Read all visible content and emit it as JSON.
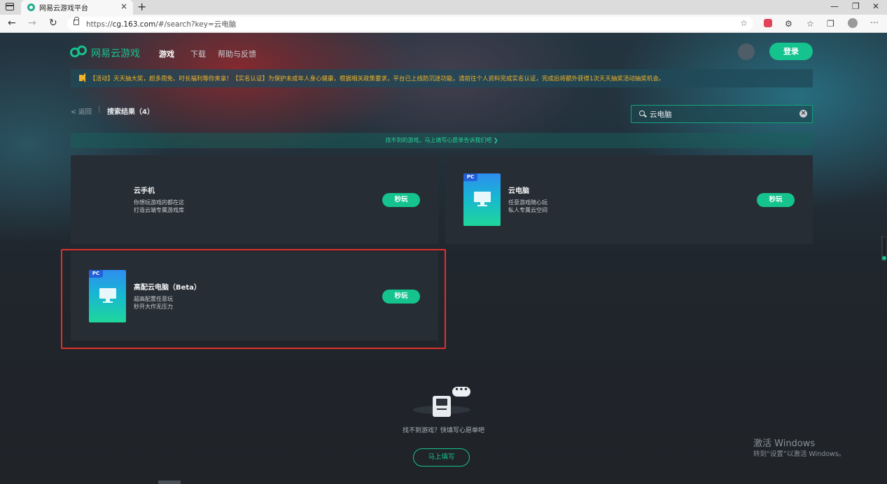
{
  "browser": {
    "tab_title": "网易云游戏平台",
    "tab_close": "×",
    "new_tab": "+",
    "url_prefix": "https://",
    "url_host": "cg.163.com",
    "url_path": "/#/search?key=云电脑",
    "win_minimize": "—",
    "win_restore": "❐",
    "win_close": "✕",
    "back": "←",
    "forward": "→",
    "reload": "↻"
  },
  "header": {
    "logo_text": "网易云游戏",
    "nav": [
      "游戏",
      "下载",
      "帮助与反馈"
    ],
    "login_label": "登录"
  },
  "notice": {
    "text": "【活动】天天抽大奖，超多周免、时长福利等你来拿！【实名认证】为保护未成年人身心健康，根据相关政策要求，平台已上线防沉迷功能，请前往个人资料完成实名认证，完成后将额外获得1次天天抽奖活动抽奖机会。"
  },
  "results": {
    "back_label": "< 返回",
    "separator": "|",
    "title": "搜索结果（4）"
  },
  "search": {
    "value": "云电脑",
    "clear": "×"
  },
  "wish_banner": "找不到的游戏，马上填写心愿单告诉我们吧 ❯",
  "cards": [
    {
      "name": "云手机",
      "desc1": "你想玩游戏的都在这",
      "desc2": "打造云端专属游戏库",
      "badge": "",
      "play": "秒玩"
    },
    {
      "name": "云电脑",
      "desc1": "任意游戏随心玩",
      "desc2": "私人专属云空间",
      "badge": "PC",
      "play": "秒玩"
    },
    {
      "name": "高配云电脑（Beta）",
      "desc1": "超高配置任意玩",
      "desc2": "秒开大作无压力",
      "badge": "PC",
      "play": "秒玩"
    }
  ],
  "empty_state": {
    "bubble": "•••",
    "text": "找不到游戏？快填写心愿单吧",
    "button": "马上填写"
  },
  "watermark": {
    "line1": "激活 Windows",
    "line2": "转到“设置”以激活 Windows。"
  },
  "colors": {
    "accent": "#14c38e",
    "notice": "#f0b429",
    "highlight": "#e0302a",
    "card_bg": "#272d34"
  }
}
